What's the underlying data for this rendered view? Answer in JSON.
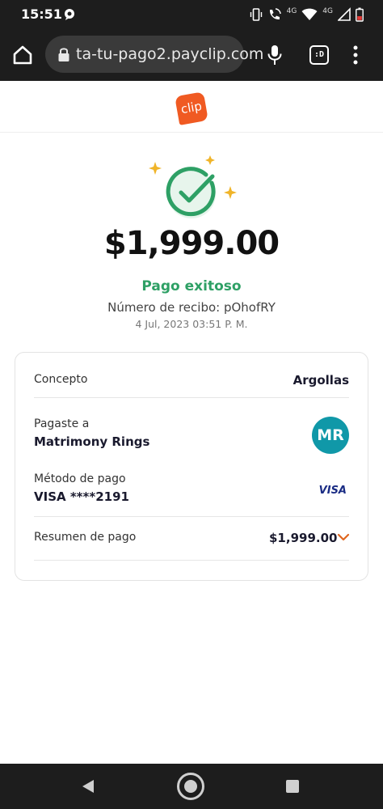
{
  "status_bar": {
    "time": "15:51",
    "network_label": "4G",
    "network_label_2": "4G",
    "icons": [
      "chat-notification-icon",
      "vibrate-icon",
      "call-wifi-icon",
      "wifi-icon",
      "signal-icon",
      "battery-low-icon"
    ]
  },
  "browser": {
    "url": "ta-tu-pago2.payclip.com",
    "tabs_label": ":D",
    "icons": [
      "home-icon",
      "lock-icon",
      "mic-icon",
      "more-vert-icon"
    ]
  },
  "header": {
    "logo_text": "clip",
    "brand_color": "#f05a22"
  },
  "payment": {
    "amount": "$1,999.00",
    "status": "Pago exitoso",
    "receipt": "Número de recibo: pOhofRY",
    "date": "4 Jul, 2023 03:51 P. M.",
    "success_color": "#2ea065"
  },
  "details": {
    "concept_label": "Concepto",
    "concept_value": "Argollas",
    "paid_to_label": "Pagaste a",
    "paid_to_value": "Matrimony Rings",
    "avatar_initials": "MR",
    "avatar_color": "#1098a8",
    "method_label": "Método de pago",
    "method_value": "VISA ****2191",
    "card_brand": "VISA",
    "summary_label": "Resumen de pago",
    "summary_value": "$1,999.00",
    "accent_color": "#e0661f"
  },
  "nav_bar": {
    "icons": [
      "back-icon",
      "home-circle-icon",
      "recents-icon"
    ]
  }
}
